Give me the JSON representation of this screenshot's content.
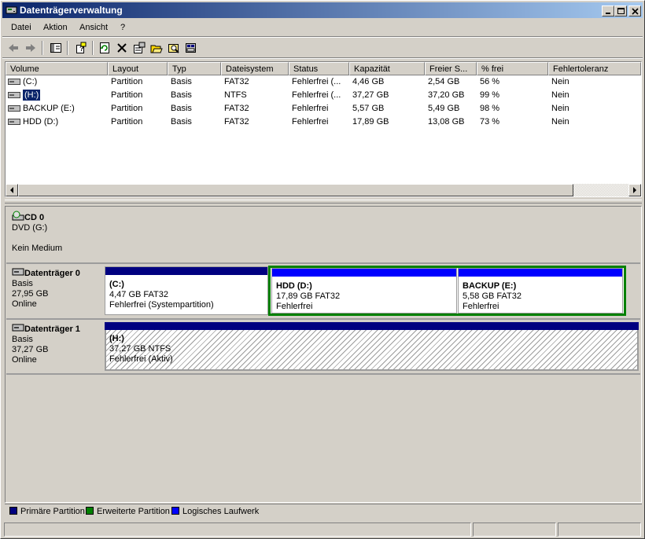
{
  "window": {
    "title": "Datenträgerverwaltung"
  },
  "menu": {
    "items": [
      "Datei",
      "Aktion",
      "Ansicht",
      "?"
    ]
  },
  "toolbar": {
    "buttons": [
      "back-icon",
      "forward-icon",
      "console-tree-icon",
      "help-icon",
      "refresh-icon",
      "delete-icon",
      "properties-icon",
      "open-icon",
      "explore-icon",
      "settings-icon"
    ]
  },
  "volumes": {
    "columns": [
      "Volume",
      "Layout",
      "Typ",
      "Dateisystem",
      "Status",
      "Kapazität",
      "Freier S...",
      "% frei",
      "Fehlertoleranz"
    ],
    "rows": [
      {
        "volume": "(C:)",
        "layout": "Partition",
        "typ": "Basis",
        "fs": "FAT32",
        "status": "Fehlerfrei (...",
        "cap": "4,46 GB",
        "free": "2,54 GB",
        "pct": "56 %",
        "ft": "Nein",
        "selected": false
      },
      {
        "volume": "(H:)",
        "layout": "Partition",
        "typ": "Basis",
        "fs": "NTFS",
        "status": "Fehlerfrei (...",
        "cap": "37,27 GB",
        "free": "37,20 GB",
        "pct": "99 %",
        "ft": "Nein",
        "selected": true
      },
      {
        "volume": "BACKUP (E:)",
        "layout": "Partition",
        "typ": "Basis",
        "fs": "FAT32",
        "status": "Fehlerfrei",
        "cap": "5,57 GB",
        "free": "5,49 GB",
        "pct": "98 %",
        "ft": "Nein",
        "selected": false
      },
      {
        "volume": "HDD (D:)",
        "layout": "Partition",
        "typ": "Basis",
        "fs": "FAT32",
        "status": "Fehlerfrei",
        "cap": "17,89 GB",
        "free": "13,08 GB",
        "pct": "73 %",
        "ft": "Nein",
        "selected": false
      }
    ]
  },
  "disks": {
    "cd0": {
      "name": "CD 0",
      "line1": "DVD (G:)",
      "line2": "Kein Medium"
    },
    "disk0": {
      "name": "Datenträger 0",
      "type": "Basis",
      "size": "27,95 GB",
      "state": "Online",
      "c": {
        "name": "(C:)",
        "size": "4,47 GB FAT32",
        "status": "Fehlerfrei (Systempartition)"
      },
      "d": {
        "name": "HDD  (D:)",
        "size": "17,89 GB FAT32",
        "status": "Fehlerfrei"
      },
      "e": {
        "name": "BACKUP  (E:)",
        "size": "5,58 GB FAT32",
        "status": "Fehlerfrei"
      }
    },
    "disk1": {
      "name": "Datenträger 1",
      "type": "Basis",
      "size": "37,27 GB",
      "state": "Online",
      "h": {
        "name": "(H:)",
        "size": "37,27 GB NTFS",
        "status": "Fehlerfrei (Aktiv)"
      }
    }
  },
  "legend": {
    "primary": "Primäre Partition",
    "extended": "Erweiterte Partition",
    "logical": "Logisches Laufwerk"
  },
  "colors": {
    "primary": "#000080",
    "extended": "#008000",
    "logical": "#0000ff",
    "title_start": "#0a246a",
    "title_end": "#a6caf0",
    "selection": "#0a246a"
  }
}
